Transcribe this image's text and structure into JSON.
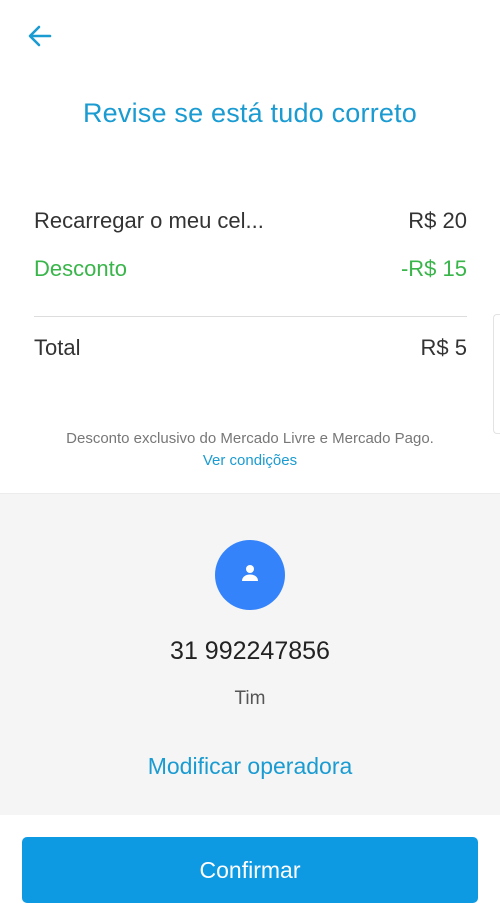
{
  "header": {
    "back_icon": "arrow-left-icon",
    "title": "Revise se está tudo correto"
  },
  "summary": {
    "item_label": "Recarregar o meu cel...",
    "item_value": "R$ 20",
    "discount_label": "Desconto",
    "discount_value": "-R$ 15",
    "total_label": "Total",
    "total_value": "R$ 5"
  },
  "disclaimer": {
    "text": "Desconto exclusivo do Mercado Livre e Mercado Pago.",
    "link": "Ver condições"
  },
  "recipient": {
    "avatar_icon": "person-icon",
    "phone": "31 992247856",
    "carrier": "Tim",
    "modify_link": "Modificar operadora"
  },
  "actions": {
    "confirm_label": "Confirmar"
  },
  "colors": {
    "accent": "#1a9bd1",
    "discount": "#39b54a",
    "avatar": "#3483fa",
    "button": "#0d9ae3"
  }
}
